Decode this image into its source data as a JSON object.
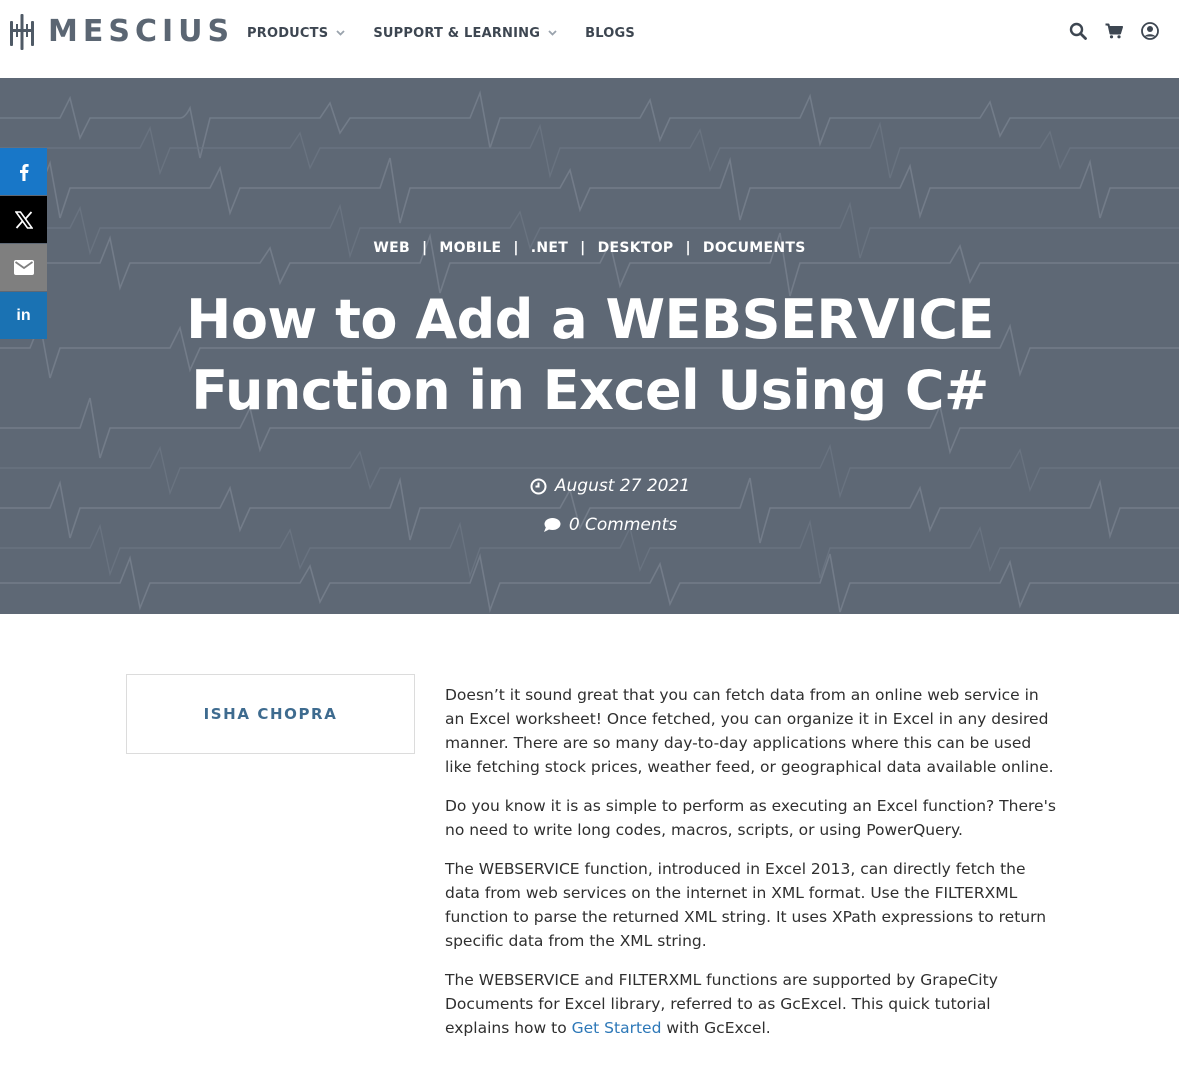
{
  "header": {
    "logo_text": "MESCIUS",
    "nav": [
      {
        "label": "PRODUCTS",
        "has_dropdown": true
      },
      {
        "label": "SUPPORT & LEARNING",
        "has_dropdown": true
      },
      {
        "label": "BLOGS",
        "has_dropdown": false
      }
    ],
    "icons": [
      "search-icon",
      "cart-icon",
      "user-icon"
    ]
  },
  "hero": {
    "categories": [
      "WEB",
      "MOBILE",
      ".NET",
      "DESKTOP",
      "DOCUMENTS"
    ],
    "separator": "|",
    "title_line1": "How to Add a WEBSERVICE",
    "title_line2": "Function in Excel Using C#",
    "date": "August 27 2021",
    "comments": "0 Comments",
    "background_color": "#5e6875"
  },
  "social": [
    {
      "name": "facebook",
      "color": "#1877c8"
    },
    {
      "name": "twitter",
      "color": "#000000"
    },
    {
      "name": "email",
      "color": "#7f7f7f"
    },
    {
      "name": "linkedin",
      "color": "#1a72b3",
      "label": "in"
    }
  ],
  "author": {
    "name": "ISHA CHOPRA"
  },
  "article": {
    "p1": "Doesn’t it sound great that you can fetch data from an online web service in an Excel worksheet! Once fetched, you can organize it in Excel in any desired manner. There are so many day-to-day applications where this can be used like fetching stock prices, weather feed, or geographical data available online.",
    "p2": "Do you know it is as simple to perform as executing an Excel function? There's no need to write long codes, macros, scripts, or using PowerQuery.",
    "p3": "The WEBSERVICE function, introduced in Excel 2013, can directly fetch the data from web services on the internet in XML format. Use the FILTERXML function to parse the returned XML string. It uses XPath expressions to return specific data from the XML string.",
    "p4_before": "The WEBSERVICE and FILTERXML functions are supported by GrapeCity Documents for Excel library, referred to as GcExcel. This quick tutorial explains how to ",
    "p4_link": "Get Started",
    "p4_after": " with GcExcel."
  }
}
